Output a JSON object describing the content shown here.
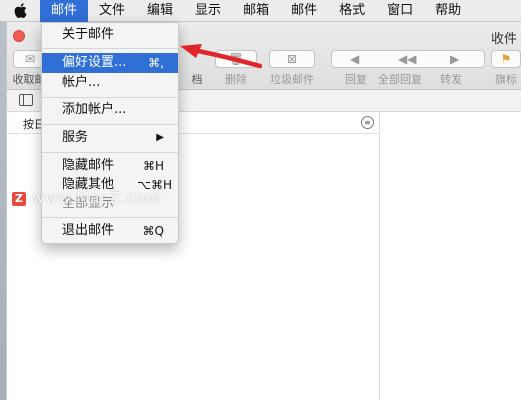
{
  "menubar": {
    "apple": "",
    "items": [
      "邮件",
      "文件",
      "编辑",
      "显示",
      "邮箱",
      "邮件",
      "格式",
      "窗口",
      "帮助"
    ]
  },
  "window": {
    "title": "收件"
  },
  "toolbar": {
    "labels": [
      "收取邮",
      "删除",
      "垃圾邮件",
      "回复",
      "全部回复",
      "转发",
      "旗标"
    ],
    "partial_label": "档"
  },
  "list": {
    "sort_label": "按日"
  },
  "mail_menu": {
    "items": [
      {
        "label": "关于邮件",
        "shortcut": ""
      },
      {
        "label": "偏好设置...",
        "shortcut": "⌘,"
      },
      {
        "label": "帐户...",
        "shortcut": ""
      },
      {
        "label": "添加帐户...",
        "shortcut": ""
      },
      {
        "label": "服务",
        "shortcut": "▶"
      },
      {
        "label": "隐藏邮件",
        "shortcut": "⌘H"
      },
      {
        "label": "隐藏其他",
        "shortcut": "⌥⌘H"
      },
      {
        "label": "全部显示",
        "shortcut": ""
      },
      {
        "label": "退出邮件",
        "shortcut": "⌘Q"
      }
    ]
  },
  "watermark": {
    "badge": "Z",
    "text": "www.MacZ.com"
  },
  "colors": {
    "highlight": "#2f6fd6",
    "arrow": "#e0262b"
  }
}
